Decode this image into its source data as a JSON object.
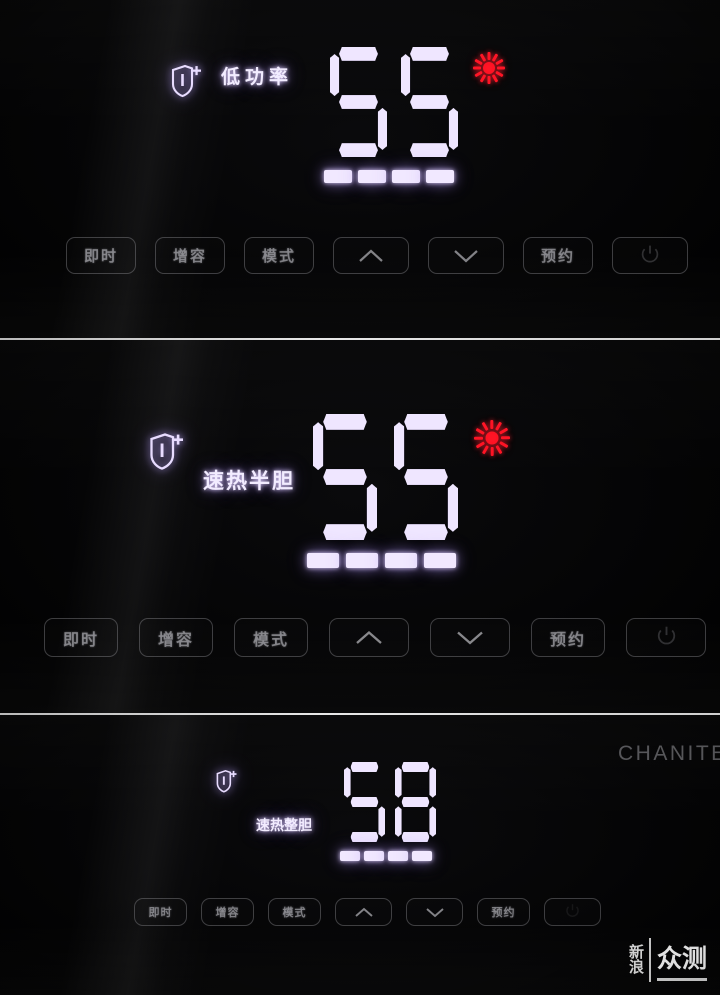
{
  "device": {
    "brand": "CHANITE",
    "watermark": {
      "left_top": "新",
      "left_bottom": "浪",
      "right": "众测"
    }
  },
  "colors": {
    "segment": "#efe6ff",
    "heating_indicator": "#ff1324",
    "button_outline": "#bebec3",
    "screen_background": "#000000",
    "label_glow": "#f2ecff"
  },
  "buttons": [
    {
      "name": "instant",
      "label": "即时",
      "icon": ""
    },
    {
      "name": "boost",
      "label": "增容",
      "icon": ""
    },
    {
      "name": "mode",
      "label": "模式",
      "icon": ""
    },
    {
      "name": "up",
      "label": "",
      "icon": "chevron-up-icon"
    },
    {
      "name": "down",
      "label": "",
      "icon": "chevron-down-icon"
    },
    {
      "name": "schedule",
      "label": "预约",
      "icon": ""
    },
    {
      "name": "power",
      "label": "",
      "icon": "power-icon"
    }
  ],
  "panels": [
    {
      "id": "panel-low-power",
      "mode_label": "低功率",
      "temperature": "55",
      "temperature_digits": [
        "5",
        "5"
      ],
      "level_bars": 4,
      "level_bars_total": 4,
      "shield_icon": "shield-plus-icon",
      "heating_icon": "heating-sun-icon",
      "heating_active": true
    },
    {
      "id": "panel-fast-heat-half",
      "mode_label": "速热半胆",
      "temperature": "55",
      "temperature_digits": [
        "5",
        "5"
      ],
      "level_bars": 4,
      "level_bars_total": 4,
      "shield_icon": "shield-plus-icon",
      "heating_icon": "heating-sun-icon",
      "heating_active": true
    },
    {
      "id": "panel-fast-heat-full",
      "mode_label": "速热整胆",
      "temperature": "58",
      "temperature_digits": [
        "5",
        "8"
      ],
      "level_bars": 4,
      "level_bars_total": 4,
      "shield_icon": "shield-plus-icon",
      "heating_icon": "heating-sun-icon",
      "heating_active": false
    }
  ]
}
